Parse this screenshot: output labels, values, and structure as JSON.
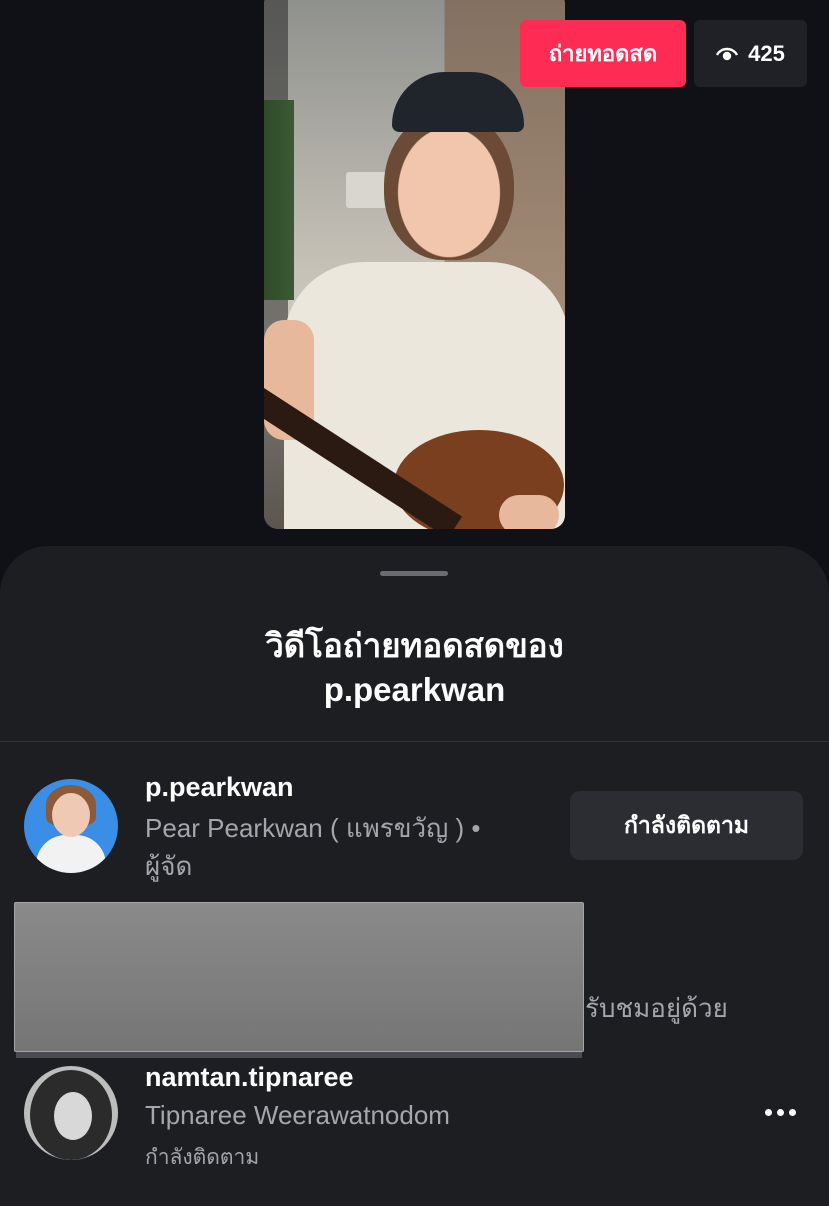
{
  "live": {
    "badge_label": "ถ่ายทอดสด",
    "viewer_count": "425",
    "viewer_icon": "eye-icon"
  },
  "sheet": {
    "title_line1": "วิดีโอถ่ายทอดสดของ",
    "title_line2": "p.pearkwan"
  },
  "host": {
    "username": "p.pearkwan",
    "display_line": "Pear Pearkwan ( แพรขวัญ ) •",
    "role": "ผู้จัด",
    "follow_label": "กำลังติดตาม"
  },
  "cohost_notice_tail": "รับชมอยู่ด้วย",
  "guest": {
    "username": "namtan.tipnaree",
    "display_name": "Tipnaree Weerawatnodom",
    "status": "กำลังติดตาม",
    "more_icon": "more-options-icon"
  },
  "colors": {
    "live_badge": "#fe2c55",
    "sheet_bg": "#1c1e22",
    "page_bg": "#0f1117"
  }
}
